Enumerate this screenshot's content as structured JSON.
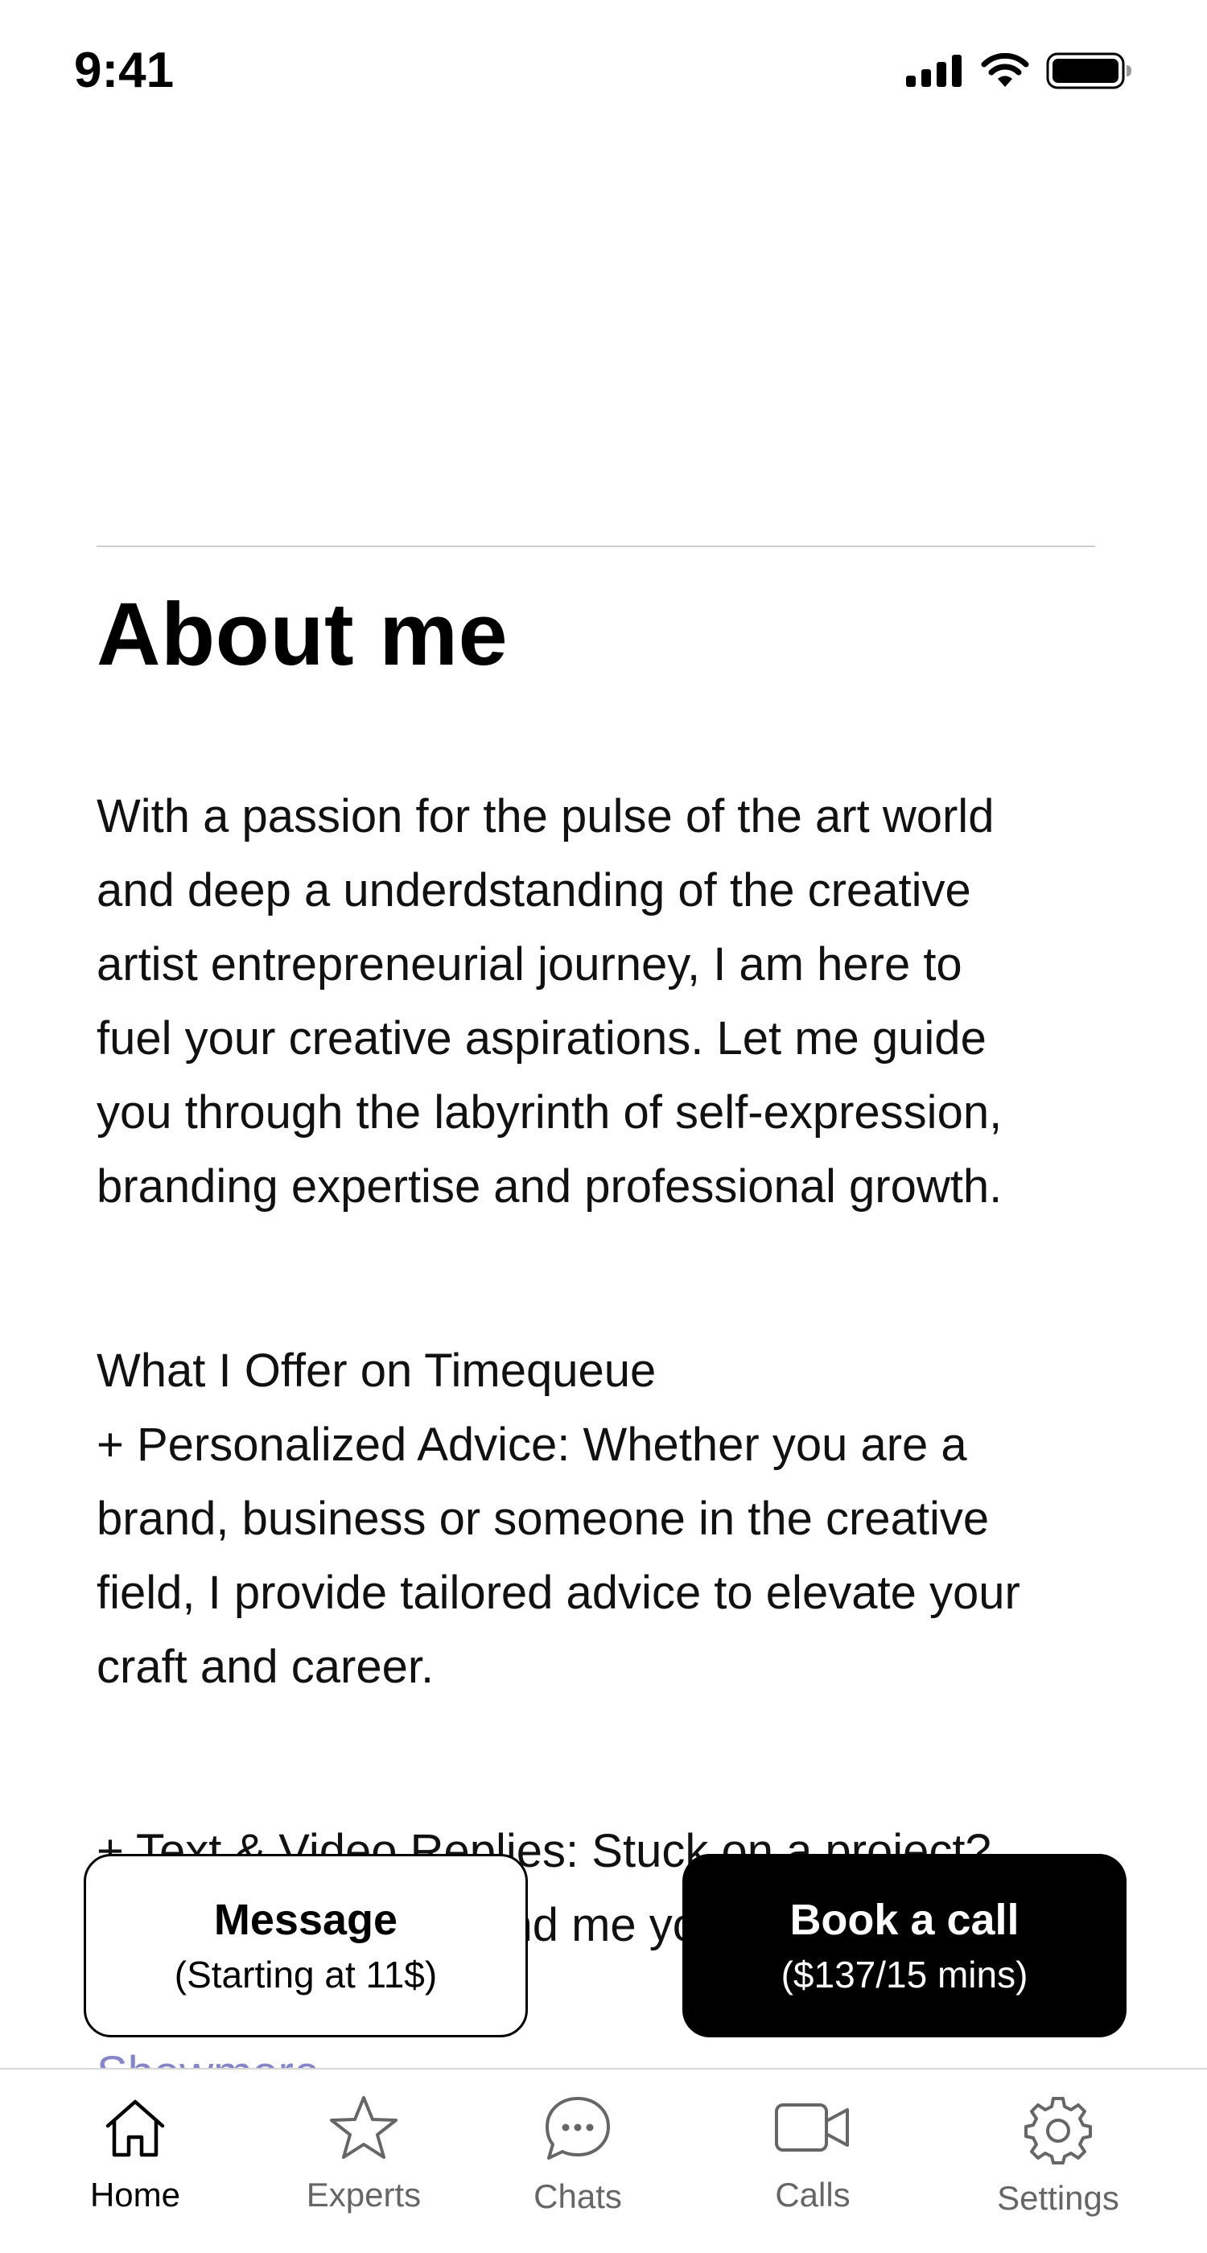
{
  "status_bar": {
    "time": "9:41",
    "icons": [
      "signal-icon",
      "wifi-icon",
      "battery-icon"
    ]
  },
  "about": {
    "title": "About me",
    "paragraph_1": "With a passion for the pulse of the art world\nand deep a underdstanding of the creative\nartist entrepreneurial journey, I am here to\nfuel your creative aspirations. Let me guide\nyou through the labyrinth of self-expression,\nbranding expertise and professional growth.",
    "paragraph_2": "What I Offer on Timequeue\n+ Personalized Advice: Whether you are a\nbrand, business or someone in the creative\nfield, I provide tailored advice to elevate your\ncraft and career.",
    "paragraph_3": "+ Text & Video Replies: Stuck on a project?\nNeed feedback? Send me your qui....",
    "show_more": "Showmore"
  },
  "actions": {
    "message": {
      "title": "Message",
      "subtitle": "(Starting at 11$)"
    },
    "book_call": {
      "title": "Book a call",
      "subtitle": "($137/15 mins)"
    }
  },
  "tab_bar": {
    "items": [
      {
        "label": "Home",
        "icon": "home-icon",
        "active": true
      },
      {
        "label": "Experts",
        "icon": "star-icon",
        "active": false
      },
      {
        "label": "Chats",
        "icon": "chat-bubble-icon",
        "active": false
      },
      {
        "label": "Calls",
        "icon": "video-camera-icon",
        "active": false
      },
      {
        "label": "Settings",
        "icon": "gear-icon",
        "active": false
      }
    ]
  },
  "colors": {
    "link": "#8585c8",
    "primary_button": "#000000",
    "inactive_tab": "#666666"
  }
}
